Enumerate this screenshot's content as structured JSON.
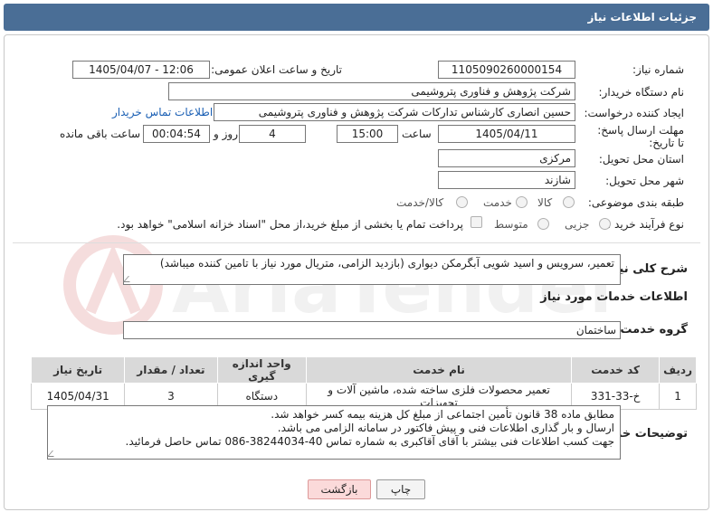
{
  "header": {
    "title": "جزئیات اطلاعات نیاز"
  },
  "fields": {
    "need_number_label": "شماره نیاز:",
    "need_number": "1105090260000154",
    "announce_label": "تاریخ و ساعت اعلان عمومی:",
    "announce_value": "1405/04/07 - 12:06",
    "buyer_org_label": "نام دستگاه خریدار:",
    "buyer_org": "شرکت پژوهش و فناوری پتروشیمی",
    "creator_label": "ایجاد کننده درخواست:",
    "creator": "حسین انصاری کارشناس تدارکات شرکت پژوهش و فناوری پتروشیمی",
    "contact_link": "اطلاعات تماس خریدار",
    "deadline_label": "مهلت ارسال پاسخ: تا تاریخ:",
    "deadline_date": "1405/04/11",
    "time_label": "ساعت",
    "deadline_time": "15:00",
    "days_value": "4",
    "days_label": "روز و",
    "remaining_time": "00:04:54",
    "remaining_label": "ساعت باقی مانده",
    "province_label": "استان محل تحویل:",
    "province": "مرکزی",
    "city_label": "شهر محل تحویل:",
    "city": "شازند",
    "category_label": "طبقه بندی موضوعی:",
    "category_options": [
      "کالا",
      "خدمت",
      "کالا/خدمت"
    ],
    "purchase_type_label": "نوع فرآیند خرید :",
    "purchase_options": [
      "جزیی",
      "متوسط"
    ],
    "payment_note": "پرداخت تمام یا بخشی از مبلغ خرید،از محل \"اسناد خزانه اسلامی\" خواهد بود."
  },
  "description": {
    "label": "شرح کلی نیاز:",
    "text": "تعمیر، سرویس و اسید شویی آبگرمکن دیواری (بازدید الزامی، متریال مورد نیاز با تامین کننده میباشد)"
  },
  "services": {
    "section_title": "اطلاعات خدمات مورد نیاز",
    "group_label": "گروه خدمت:",
    "group_value": "ساختمان",
    "columns": [
      "ردیف",
      "کد خدمت",
      "نام خدمت",
      "واحد اندازه گیری",
      "تعداد / مقدار",
      "تاریخ نیاز"
    ],
    "rows": [
      [
        "1",
        "خ-33-331",
        "تعمیر محصولات فلزی ساخته شده، ماشین آلات و تجهیزات",
        "دستگاه",
        "3",
        "1405/04/31"
      ]
    ]
  },
  "buyer_notes": {
    "label": "توضیحات خریدار:",
    "lines": [
      "مطابق ماده 38 قانون تأمین اجتماعی از مبلغ کل هزینه بیمه کسر خواهد شد.",
      "ارسال و بار گذاری اطلاعات فنی و پیش فاکتور در سامانه الزامی می باشد.",
      "جهت کسب اطلاعات فنی بیشتر با آقای آقاکبری به شماره تماس  40-38244034-086 تماس حاصل فرمائید."
    ]
  },
  "buttons": {
    "print": "چاپ",
    "back": "بازگشت"
  },
  "watermark": {
    "text": "AriaTender.neT"
  },
  "colors": {
    "header_bg": "#4a6e96",
    "link": "#1a5fb4",
    "back_button": "#fbdada"
  }
}
